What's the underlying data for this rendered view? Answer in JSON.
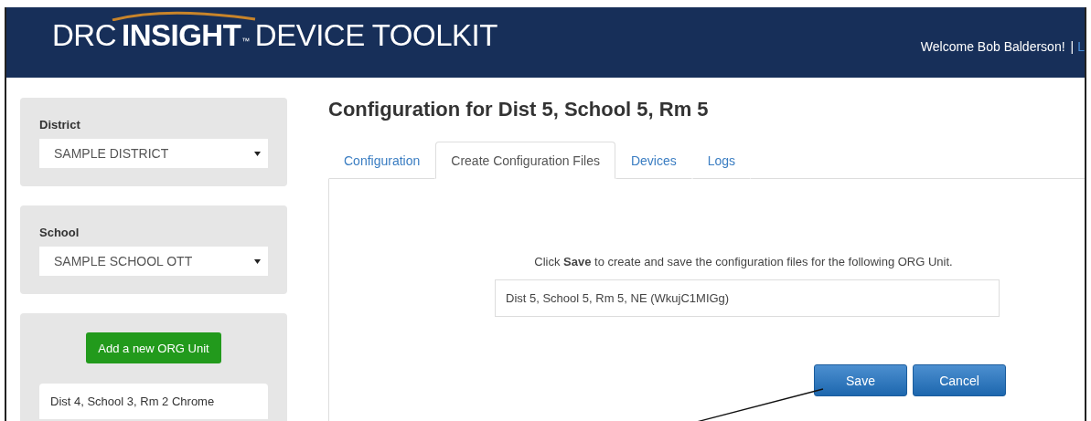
{
  "header": {
    "logo": {
      "brand": "DRC",
      "product": "INSIGHT",
      "trademark": "™",
      "suffix": "DEVICE TOOLKIT"
    },
    "welcome": "Welcome Bob Balderson!",
    "separator": "|",
    "link": "L"
  },
  "sidebar": {
    "panels": [
      {
        "kind": "select",
        "label": "District",
        "value": "SAMPLE DISTRICT"
      },
      {
        "kind": "select",
        "label": "School",
        "value": "SAMPLE SCHOOL OTT"
      },
      {
        "kind": "units",
        "button": "Add a new ORG Unit",
        "items": [
          "Dist 4, School 3, Rm 2 Chrome"
        ]
      }
    ]
  },
  "main": {
    "title": "Configuration for Dist 5, School 5, Rm 5",
    "tabs": [
      {
        "label": "Configuration",
        "selected": false
      },
      {
        "label": "Create Configuration Files",
        "selected": true
      },
      {
        "label": "Devices",
        "selected": false
      },
      {
        "label": "Logs",
        "selected": false
      }
    ],
    "prompt": "Click **Save** to create and save the configuration files for the following ORG Unit.",
    "org_unit": "Dist 5, School 5, Rm 5, NE (WkujC1MIGg)",
    "buttons": [
      "Save",
      "Cancel"
    ]
  }
}
